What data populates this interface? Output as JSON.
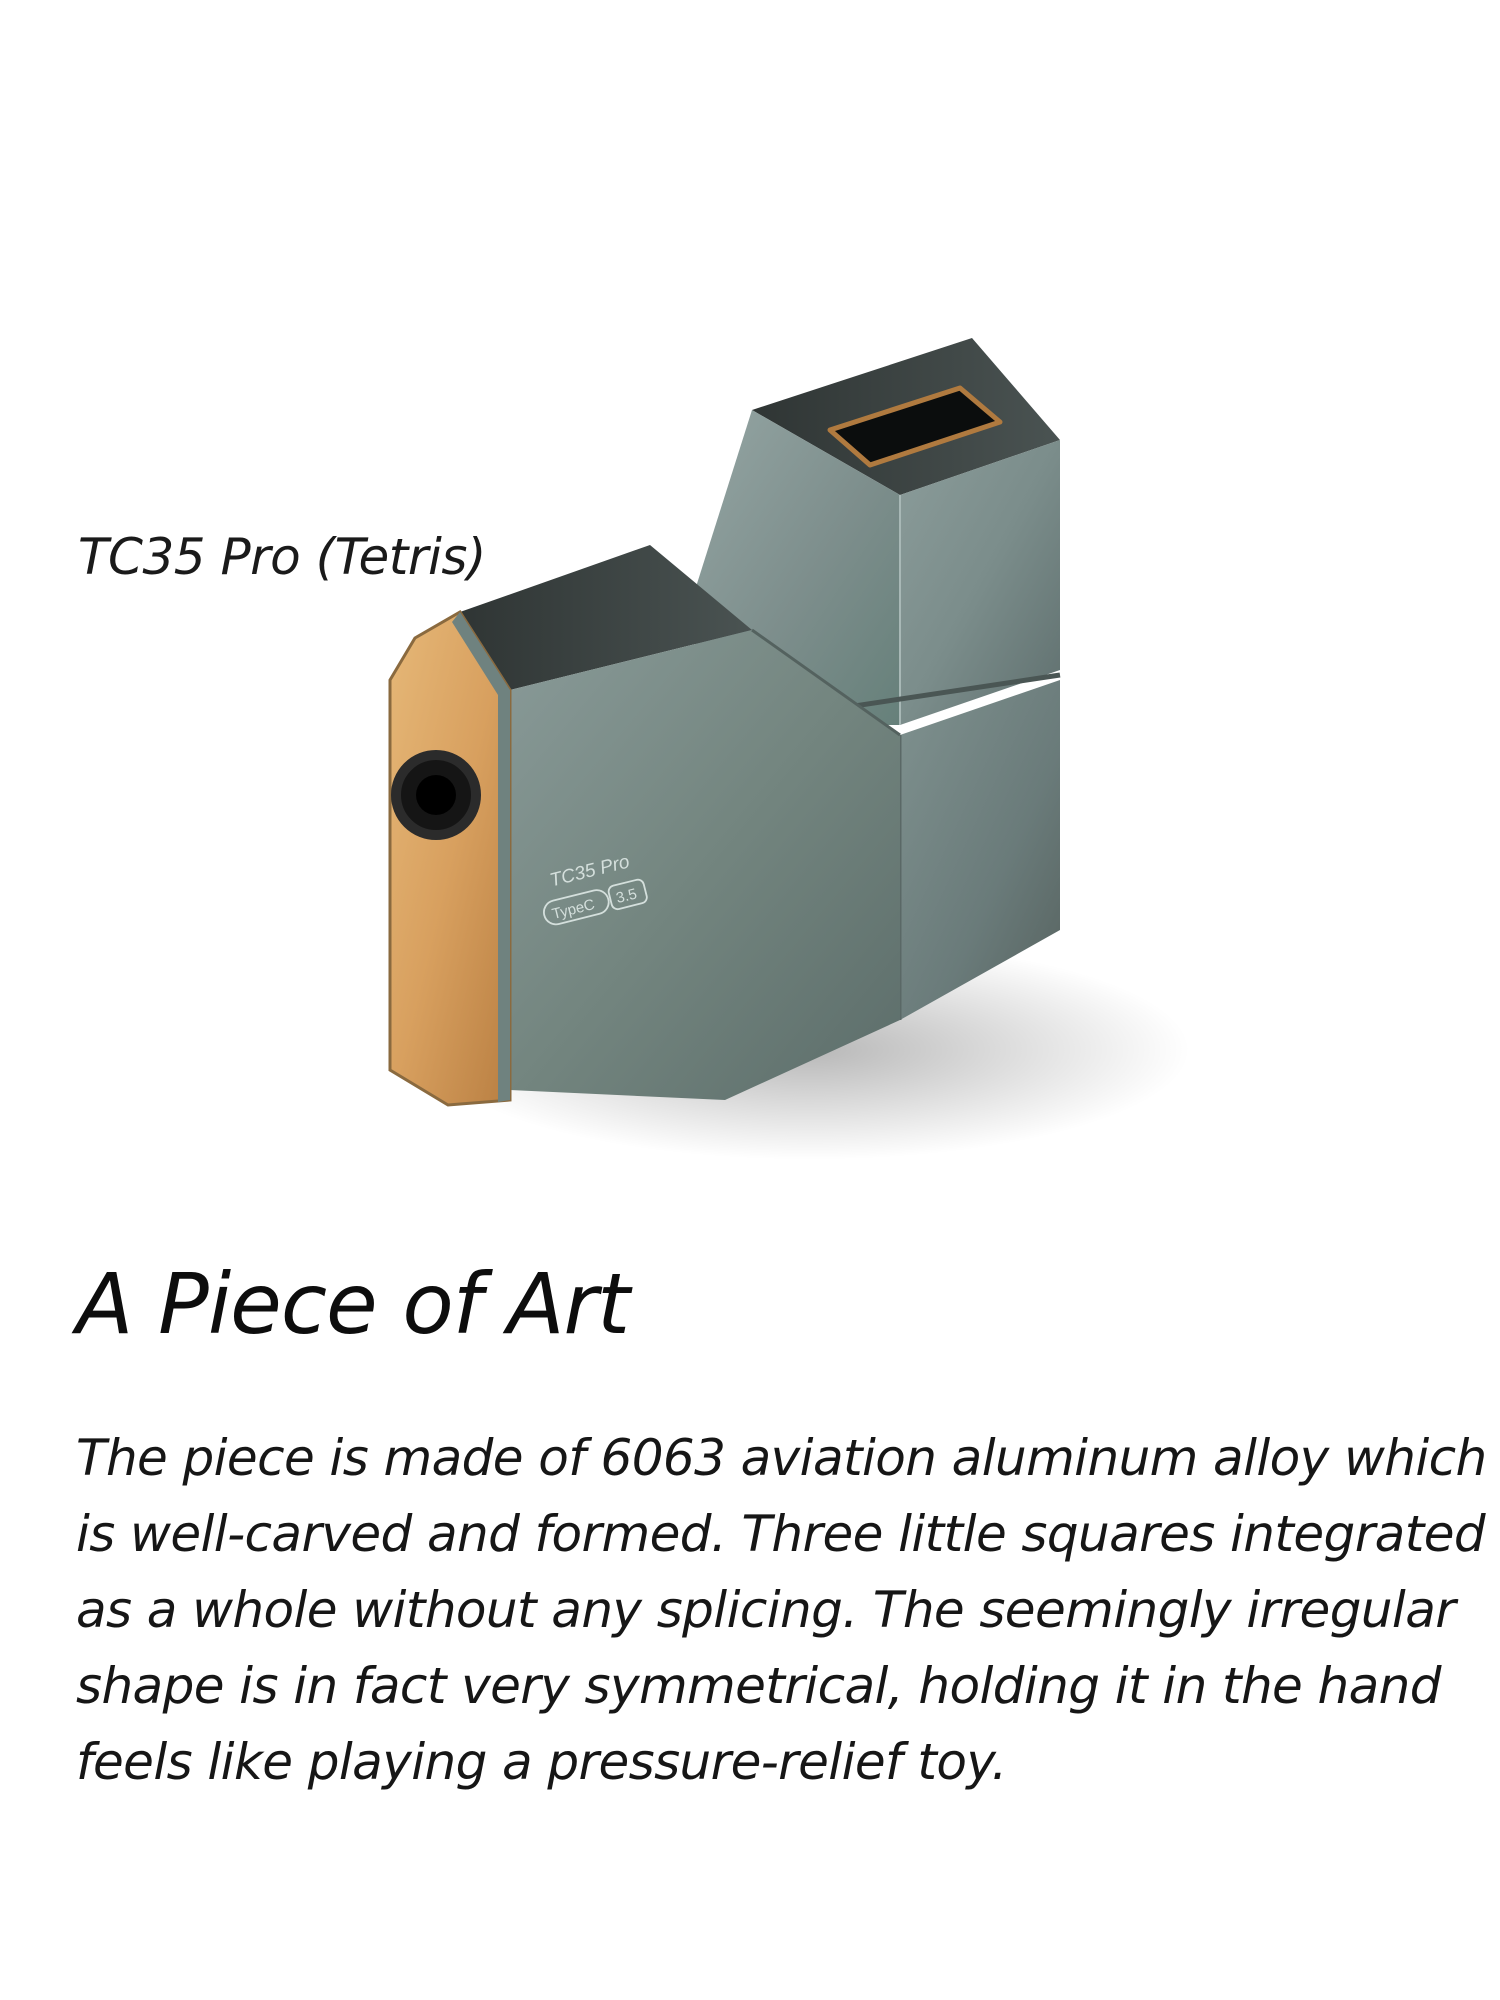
{
  "product": {
    "name": "TC35 Pro (Tetris)",
    "engraving_model": "TC35 Pro",
    "engraving_input": "TypeC",
    "engraving_output": "3.5"
  },
  "headline": "A Piece of Art",
  "description_lines": [
    "The piece is made of 6063 aviation aluminum alloy which",
    "is well-carved and formed. Three little squares integrated",
    "as a whole without any splicing. The seemingly irregular",
    "shape is in fact very symmetrical, holding it in the hand",
    "feels like playing a pressure-relief toy."
  ],
  "colors": {
    "background": "#ffffff",
    "metal": "#7e8f8e",
    "metal_dark": "#3b4343",
    "gold_plate": "#d9a461",
    "text": "#111111"
  }
}
